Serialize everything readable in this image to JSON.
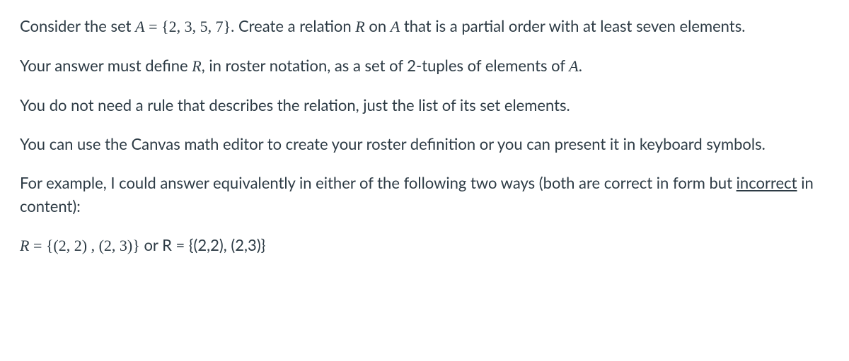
{
  "p1": {
    "t1": "Consider the set ",
    "A": "A",
    "eq": " = ",
    "set": "{2, 3, 5, 7}",
    "t2": ". Create a relation ",
    "R": "R",
    "t3": " on ",
    "A2": "A",
    "t4": " that is a partial order with at least seven elements."
  },
  "p2": {
    "t1": "Your answer must define ",
    "R": "R",
    "t2": ", in roster notation, as a set of 2-tuples of elements of ",
    "A": "A",
    "t3": "."
  },
  "p3": "You do not need a rule that describes the relation, just the list of its set elements.",
  "p4": "You can use the Canvas math editor to create your roster definition or you can present it in keyboard symbols.",
  "p5": {
    "t1": "For example, I could answer equivalently in either of the following two ways (both are correct in form but ",
    "u": "incorrect",
    "t2": " in content):"
  },
  "p6": {
    "R": "R",
    "eq": " = ",
    "set1": "{(2, 2) , (2, 3)}",
    "or": " or ",
    "plain": " R = {(2,2), (2,3)}"
  }
}
